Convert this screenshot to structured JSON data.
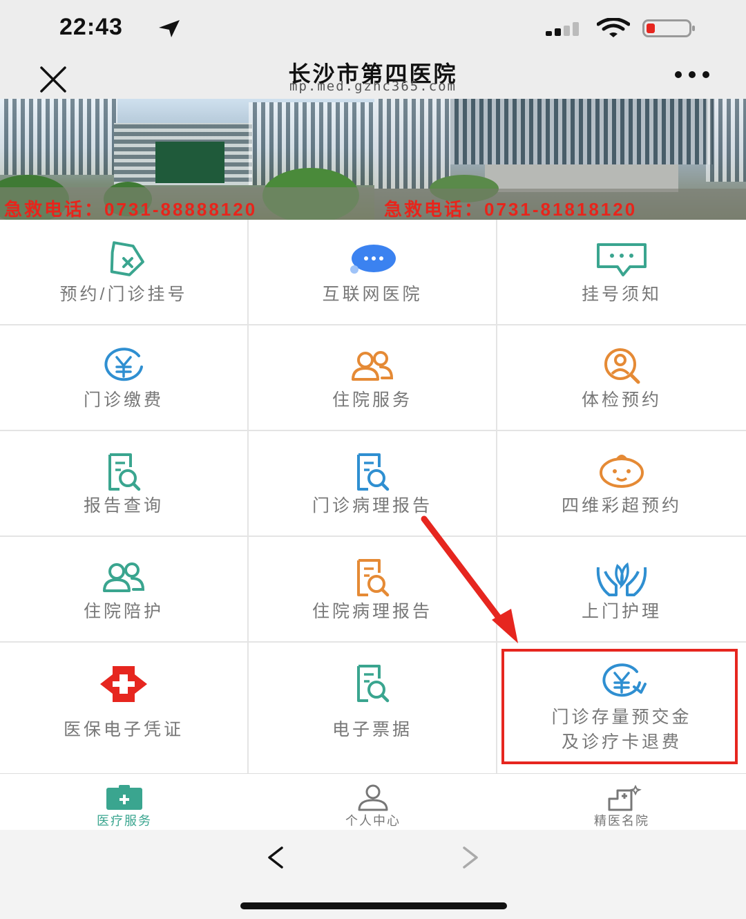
{
  "status": {
    "time": "22:43"
  },
  "header": {
    "title": "长沙市第四医院",
    "subtitle": "mp.med.gzhc365.com",
    "close_icon": "close-icon",
    "more_icon": "more-icon"
  },
  "banner": {
    "left_text": "急救电话：0731-88888120",
    "right_text": "急救电话：0731-81818120"
  },
  "grid": {
    "items": [
      {
        "label": "预约/门诊挂号",
        "icon": "ticket-icon",
        "color": "#3aa58f"
      },
      {
        "label": "互联网医院",
        "icon": "chat-bubble-icon",
        "color": "#3b82f0"
      },
      {
        "label": "挂号须知",
        "icon": "message-icon",
        "color": "#3aa58f"
      },
      {
        "label": "门诊缴费",
        "icon": "yuan-coin-icon",
        "color": "#2f8fd1"
      },
      {
        "label": "住院服务",
        "icon": "people-icon",
        "color": "#e58a35"
      },
      {
        "label": "体检预约",
        "icon": "person-search-icon",
        "color": "#e58a35"
      },
      {
        "label": "报告查询",
        "icon": "report-search-icon",
        "color": "#3aa58f"
      },
      {
        "label": "门诊病理报告",
        "icon": "report-search-icon",
        "color": "#2f8fd1"
      },
      {
        "label": "四维彩超预约",
        "icon": "baby-face-icon",
        "color": "#e58a35"
      },
      {
        "label": "住院陪护",
        "icon": "people-icon",
        "color": "#3aa58f"
      },
      {
        "label": "住院病理报告",
        "icon": "report-search-icon",
        "color": "#e58a35"
      },
      {
        "label": "上门护理",
        "icon": "care-hands-icon",
        "color": "#2f8fd1"
      },
      {
        "label": "医保电子凭证",
        "icon": "medical-cross-icon",
        "color": "#e6261f"
      },
      {
        "label": "电子票据",
        "icon": "report-search-icon",
        "color": "#3aa58f"
      },
      {
        "label": "门诊存量预交金",
        "label2": "及诊疗卡退费",
        "icon": "yuan-refund-icon",
        "color": "#2f8fd1"
      }
    ]
  },
  "tabbar": {
    "tabs": [
      {
        "label": "医疗服务",
        "icon": "medical-kit-icon",
        "active": true
      },
      {
        "label": "个人中心",
        "icon": "user-icon",
        "active": false
      },
      {
        "label": "精医名院",
        "icon": "hospital-icon",
        "active": false
      }
    ]
  },
  "colors": {
    "accent": "#3aa58f",
    "highlight": "#e6261f"
  }
}
